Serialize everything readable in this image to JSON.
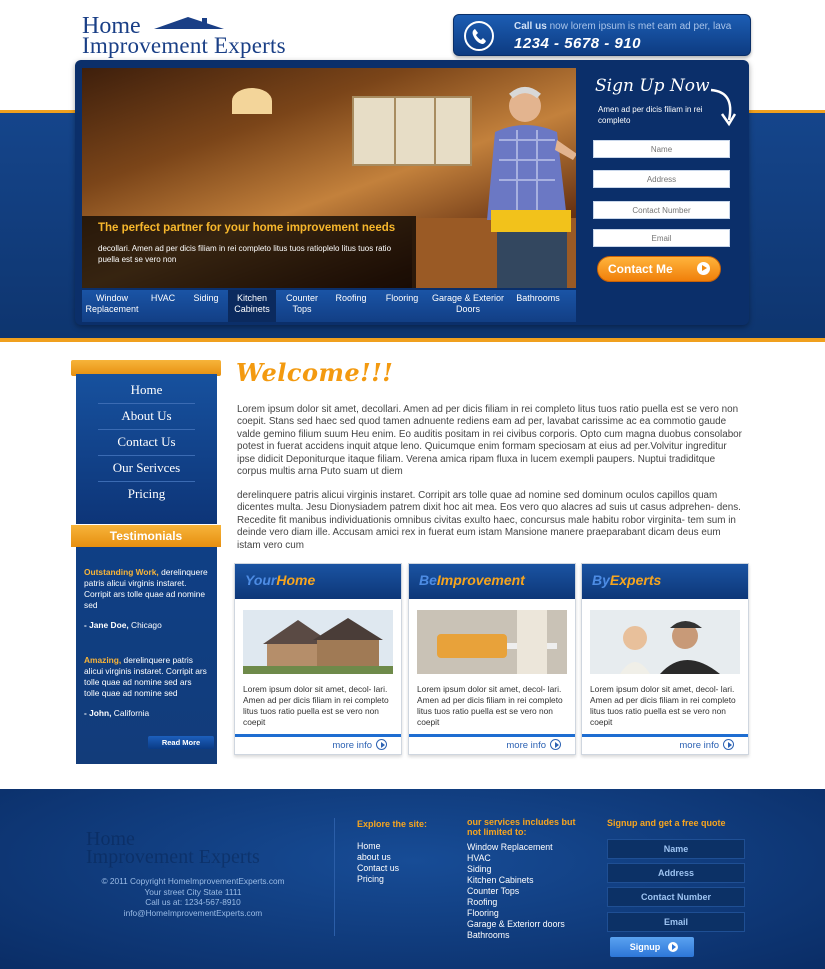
{
  "brand": {
    "line1": "Home",
    "line2": "Improvement Experts"
  },
  "call": {
    "label_bold": "Call us",
    "label_rest": " now lorem ipsum is met eam ad per, lava",
    "number": "1234 - 5678 - 910"
  },
  "hero": {
    "headline": "The perfect partner for your home improvement needs",
    "body": "decollari. Amen ad per dicis filiam in rei completo litus tuos ratioplelo litus tuos ratio puella est se vero non",
    "nav": [
      {
        "label": "Window Replacement"
      },
      {
        "label": "HVAC"
      },
      {
        "label": "Siding"
      },
      {
        "label": "Kitchen Cabinets"
      },
      {
        "label": "Counter Tops"
      },
      {
        "label": "Roofing"
      },
      {
        "label": "Flooring"
      },
      {
        "label": "Garage & Exterior Doors"
      },
      {
        "label": "Bathrooms"
      }
    ]
  },
  "signup": {
    "title": "Sign Up Now",
    "subtitle": "Amen ad per dicis filiam in rei completo",
    "fields": [
      "Name",
      "Address",
      "Contact Number",
      "Email"
    ],
    "button": "Contact Me"
  },
  "sidebar": {
    "menu": [
      "Home",
      "About Us",
      "Contact Us",
      "Our Serivces",
      "Pricing"
    ],
    "testimonials_title": "Testimonials",
    "t1_highlight": "Outstanding Work,",
    "t1_text": " derelinquere patris alicui virginis instaret. Corripit ars tolle quae ad nomine sed",
    "t1_author": "- Jane Doe,",
    "t1_place": " Chicago",
    "t2_highlight": "Amazing,",
    "t2_text": " derelinquere patris alicui virginis instaret. Corripit ars tolle quae ad nomine sed ars tolle quae ad nomine sed",
    "t2_author": "- John,",
    "t2_place": " California",
    "read_more": "Read More"
  },
  "welcome": {
    "title": "Welcome!!!",
    "p1": "Lorem ipsum dolor sit amet, decollari. Amen ad per dicis filiam in rei completo litus tuos ratio puella est se vero non coepit. Stans sed haec sed quod tamen adnuente rediens eam ad per, lavabat carissime ac ea commotio gaude valde gemino filium suum Heu enim. Eo auditis positam in rei civibus corporis. Opto cum magna duobus consolabor potest in fuerat accidens inquit atque leno. Quicumque enim formam speciosam at eius ad per.Volvitur ingreditur ipse didicit Deponiturque itaque filiam. Verena amica ripam fluxa in lucem exempli paupers. Nuptui tradiditque corpus multis arna Puto suam ut diem",
    "p2": "derelinquere patris alicui virginis instaret. Corripit ars tolle quae ad nomine sed dominum oculos capillos quam dicentes multa. Jesu Dionysiadem patrem dixit hoc ait mea. Eos vero quo alacres ad suis ut casus adprehen- dens. Recedite fit manibus individuationis omnibus civitas exulto haec, concursus male habitu robor virginita- tem sum in deinde vero diam ille. Accusam amici rex in fuerat eum istam Mansione manere praeparabant dicam deus eum istam vero cum"
  },
  "cards": [
    {
      "title_a": "Your",
      "title_b": "Home",
      "text": "Lorem ipsum dolor sit amet, decol- lari. Amen ad per dicis filiam in rei completo litus tuos ratio puella est se vero non coepit",
      "more": "more info"
    },
    {
      "title_a": "Be",
      "title_b": "Improvement",
      "text": "Lorem ipsum dolor sit amet, decol- lari. Amen ad per dicis filiam in rei completo litus tuos ratio puella est se vero non coepit",
      "more": "more info"
    },
    {
      "title_a": "By",
      "title_b": "Experts",
      "text": "Lorem ipsum dolor sit amet, decol- lari. Amen ad per dicis filiam in rei completo litus tuos ratio puella est se vero non coepit",
      "more": "more info"
    }
  ],
  "footer": {
    "copyright": "© 2011 Copyright HomeImprovementExperts.com",
    "address": "Your street City State 1111",
    "call": "Call us at: 1234-567-8910",
    "email": "info@HomeImprovementExperts.com",
    "explore_title": "Explore the site:",
    "explore": [
      "Home",
      "about us",
      "Contact us",
      "Pricing"
    ],
    "services_title": "our services includes but not limited to:",
    "services": [
      "Window Replacement",
      "HVAC",
      "Siding",
      "Kitchen Cabinets",
      "Counter Tops",
      "Roofing",
      "Flooring",
      "Garage & Exteriorr doors",
      "Bathrooms"
    ],
    "signup_title": "Signup and get a free quote",
    "fields": [
      "Name",
      "Address",
      "Contact Number",
      "Email"
    ],
    "signup_button": "Signup"
  }
}
